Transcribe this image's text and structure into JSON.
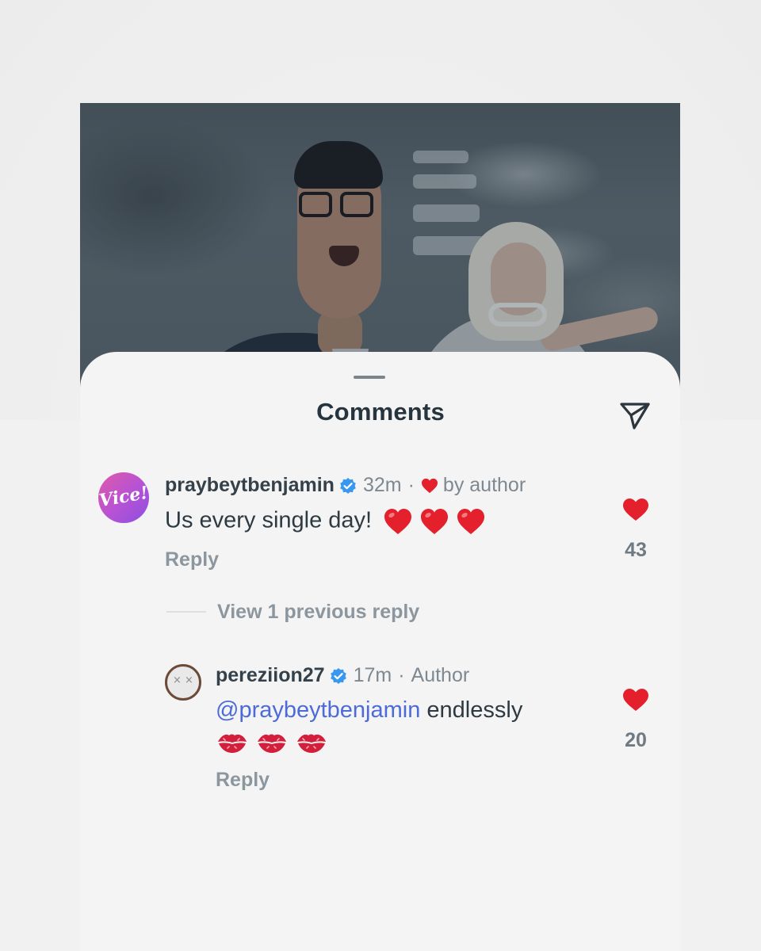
{
  "sheet": {
    "title": "Comments",
    "share_icon": "paper-plane-icon"
  },
  "comments": [
    {
      "avatar_text": "Vice!",
      "username": "praybeytbenjamin",
      "verified": true,
      "time": "32m",
      "separator": "·",
      "liked_by_author_label": "by author",
      "text": "Us every single day!",
      "emoji": [
        "red-heart",
        "red-heart",
        "red-heart"
      ],
      "reply_label": "Reply",
      "likes": "43"
    }
  ],
  "thread": {
    "view_replies_label": "View 1 previous reply"
  },
  "replies": [
    {
      "avatar_text": "× ×",
      "username": "pereziion27",
      "verified": true,
      "time": "17m",
      "separator": "·",
      "role_label": "Author",
      "mention": "@praybeytbenjamin",
      "text": "endlessly",
      "emoji": [
        "kiss-mark",
        "kiss-mark",
        "kiss-mark"
      ],
      "reply_label": "Reply",
      "likes": "20"
    }
  ],
  "colors": {
    "accent_heart": "#e3202c",
    "verified_blue": "#3897f0",
    "mention_blue": "#4d6bd8",
    "text_dark": "#2e3a42",
    "text_muted": "#8c969e"
  }
}
